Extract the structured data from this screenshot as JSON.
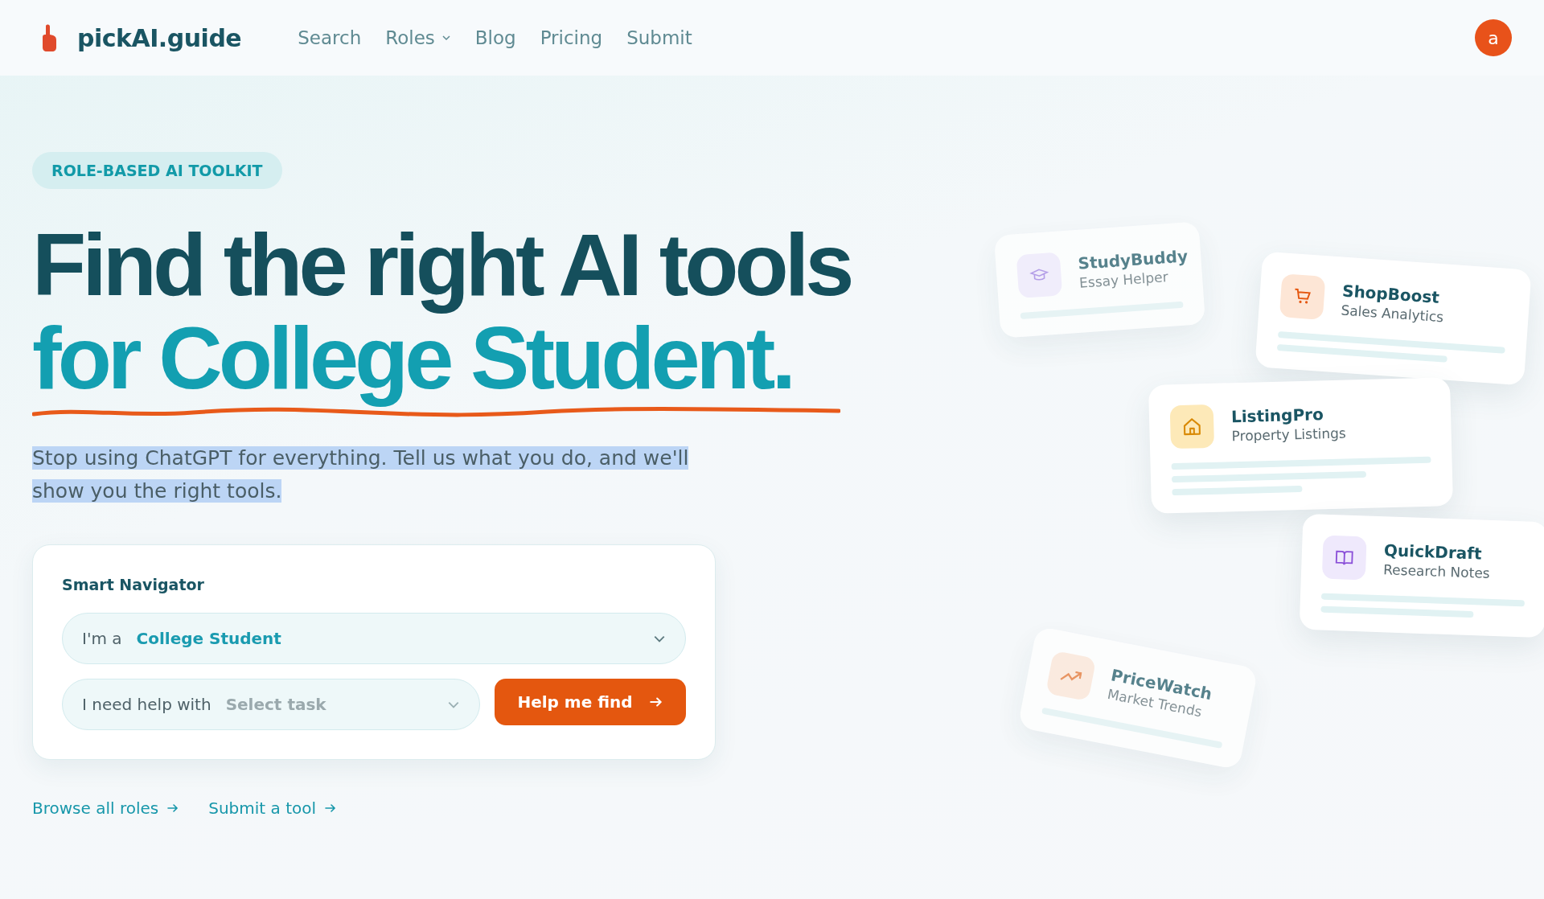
{
  "header": {
    "logo_text": "pickAI.guide",
    "nav": [
      {
        "label": "Search",
        "dropdown": false
      },
      {
        "label": "Roles",
        "dropdown": true
      },
      {
        "label": "Blog",
        "dropdown": false
      },
      {
        "label": "Pricing",
        "dropdown": false
      },
      {
        "label": "Submit",
        "dropdown": false
      }
    ],
    "avatar_letter": "a"
  },
  "hero": {
    "badge": "ROLE-BASED AI TOOLKIT",
    "headline_line1": "Find the right AI tools",
    "headline_line2": "for College Student.",
    "intro": {
      "text": "Stop using ChatGPT for everything. Tell us what you do, and we'll show you the right tools.",
      "highlighted": true
    }
  },
  "navigator": {
    "title": "Smart Navigator",
    "role_field": {
      "label": "I'm a",
      "value": "College Student"
    },
    "task_field": {
      "label": "I need help with",
      "placeholder": "Select task"
    },
    "button": "Help me find"
  },
  "links": [
    "Browse all roles",
    "Submit a tool"
  ],
  "tool_cards": [
    {
      "name": "StudyBuddy",
      "subtitle": "Essay Helper",
      "kind": "cap",
      "color": "#efe9fc",
      "faded": true
    },
    {
      "name": "ShopBoost",
      "subtitle": "Sales Analytics",
      "kind": "cart",
      "color": "#fde6d6",
      "faded": false
    },
    {
      "name": "ListingPro",
      "subtitle": "Property Listings",
      "kind": "house",
      "color": "#fde9b8",
      "faded": false
    },
    {
      "name": "QuickDraft",
      "subtitle": "Research Notes",
      "kind": "book",
      "color": "#efe9fc",
      "faded": false
    },
    {
      "name": "PriceWatch",
      "subtitle": "Market Trends",
      "kind": "trend",
      "color": "#fde6d6",
      "faded": true
    }
  ]
}
